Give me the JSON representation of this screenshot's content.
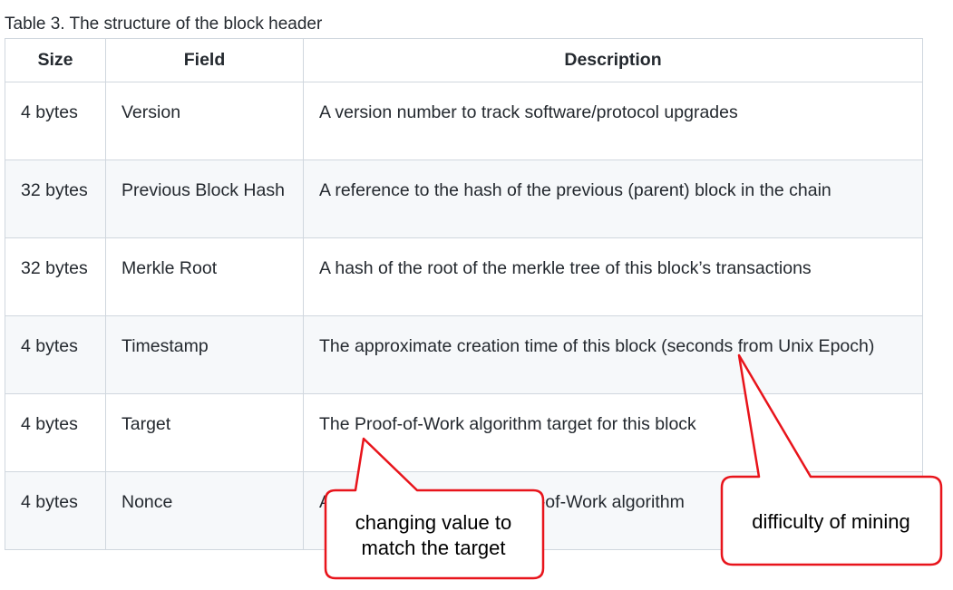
{
  "caption": "Table 3. The structure of the block header",
  "table": {
    "headers": [
      "Size",
      "Field",
      "Description"
    ],
    "rows": [
      {
        "size": "4 bytes",
        "field": "Version",
        "description": "A version number to track software/protocol upgrades"
      },
      {
        "size": "32 bytes",
        "field": "Previous Block Hash",
        "description": "A reference to the hash of the previous (parent) block in the chain"
      },
      {
        "size": "32 bytes",
        "field": "Merkle Root",
        "description": "A hash of the root of the merkle tree of this block’s transactions"
      },
      {
        "size": "4 bytes",
        "field": "Timestamp",
        "description": "The approximate creation time of this block (seconds from Unix Epoch)"
      },
      {
        "size": "4 bytes",
        "field": "Target",
        "description": "The Proof-of-Work algorithm target for this block"
      },
      {
        "size": "4 bytes",
        "field": "Nonce",
        "description": "A counter used for the Proof-of-Work algorithm"
      }
    ]
  },
  "callouts": {
    "nonce": {
      "line1": "changing value to",
      "line2": "match the target"
    },
    "target": {
      "text": "difficulty of mining"
    }
  },
  "colors": {
    "callout_border": "#e8141b",
    "row_alt": "#f6f8fa",
    "grid": "#d0d7de"
  }
}
